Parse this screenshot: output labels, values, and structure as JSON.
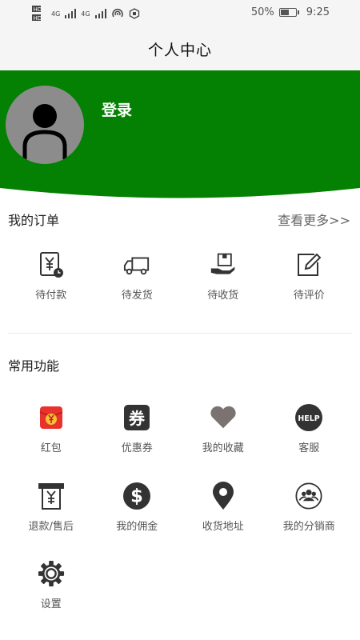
{
  "status_bar": {
    "network1": "4G",
    "network2": "4G",
    "battery_percent": "50%",
    "battery_level": 0.5,
    "time": "9:25"
  },
  "header": {
    "title": "个人中心"
  },
  "profile": {
    "login_label": "登录",
    "header_color": "#048003"
  },
  "orders": {
    "title": "我的订单",
    "more_label": "查看更多>>",
    "items": [
      {
        "label": "待付款",
        "icon": "payment-pending-icon"
      },
      {
        "label": "待发货",
        "icon": "truck-icon"
      },
      {
        "label": "待收货",
        "icon": "package-hand-icon"
      },
      {
        "label": "待评价",
        "icon": "edit-review-icon"
      }
    ]
  },
  "functions": {
    "title": "常用功能",
    "items": [
      {
        "label": "红包",
        "icon": "red-packet-icon"
      },
      {
        "label": "优惠券",
        "icon": "coupon-icon",
        "glyph": "券"
      },
      {
        "label": "我的收藏",
        "icon": "heart-icon"
      },
      {
        "label": "客服",
        "icon": "help-icon",
        "glyph": "HELP"
      },
      {
        "label": "退款/售后",
        "icon": "refund-icon"
      },
      {
        "label": "我的佣金",
        "icon": "dollar-icon",
        "glyph": "$"
      },
      {
        "label": "收货地址",
        "icon": "location-pin-icon"
      },
      {
        "label": "我的分销商",
        "icon": "group-icon"
      },
      {
        "label": "设置",
        "icon": "settings-gear-icon"
      }
    ]
  }
}
